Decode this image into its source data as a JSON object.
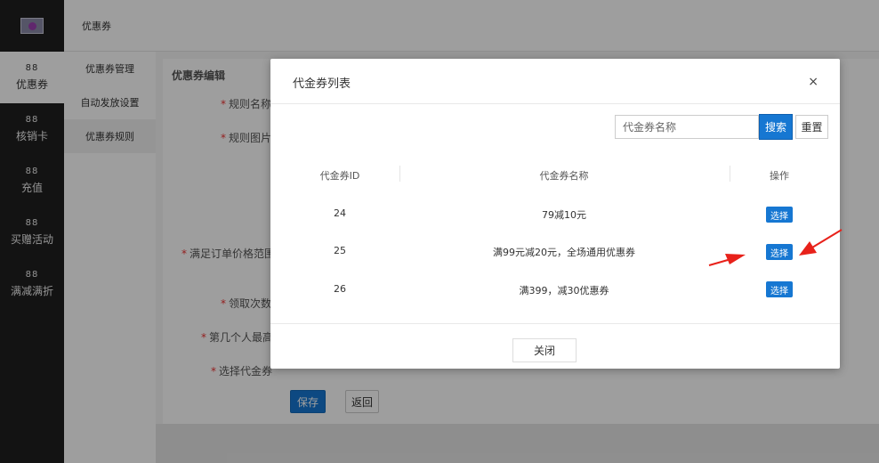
{
  "header": {
    "title": "优惠券"
  },
  "left_nav": {
    "items": [
      {
        "icon": "88",
        "label": "优惠券"
      },
      {
        "icon": "88",
        "label": "核销卡"
      },
      {
        "icon": "88",
        "label": "充值"
      },
      {
        "icon": "88",
        "label": "买赠活动"
      },
      {
        "icon": "88",
        "label": "满减满折"
      }
    ]
  },
  "sub_nav": {
    "items": [
      {
        "label": "优惠券管理"
      },
      {
        "label": "自动发放设置"
      },
      {
        "label": "优惠券规则"
      }
    ]
  },
  "form": {
    "title": "优惠券编辑",
    "labels": {
      "rule_name": "规则名称",
      "rule_image": "规则图片",
      "order_range": "满足订单价格范围",
      "claim_times": "领取次数",
      "nth_person": "第几个人最高",
      "pick_coupon": "选择代金券"
    },
    "save_label": "保存",
    "back_label": "返回"
  },
  "modal": {
    "title": "代金券列表",
    "close_icon": "×",
    "search": {
      "placeholder": "代金券名称",
      "search_label": "搜索",
      "reset_label": "重置"
    },
    "columns": [
      "代金券ID",
      "代金券名称",
      "操作"
    ],
    "rows": [
      {
        "id": "24",
        "name": "79减10元",
        "action": "选择"
      },
      {
        "id": "25",
        "name": "满99元减20元，全场通用优惠券",
        "action": "选择"
      },
      {
        "id": "26",
        "name": "满399，减30优惠券",
        "action": "选择"
      }
    ],
    "close_label": "关闭"
  },
  "colors": {
    "primary": "#1677d2",
    "nav_bg": "#1f1f1f",
    "annotation_arrow": "#e8211a"
  }
}
